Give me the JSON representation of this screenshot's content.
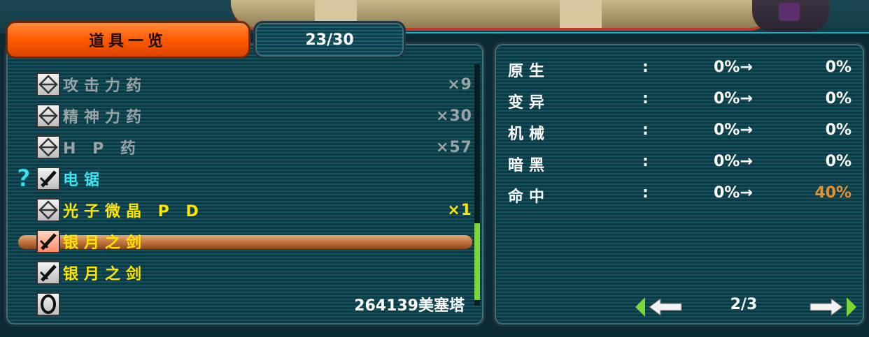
{
  "tabs": {
    "items_label": "道具一览",
    "count": "23/30"
  },
  "items": [
    {
      "name": "攻击力药",
      "qty": "×9",
      "color": "gray",
      "icon": "potion-icon",
      "unidentified": false,
      "selected": false
    },
    {
      "name": "精神力药",
      "qty": "×30",
      "color": "gray",
      "icon": "potion-icon",
      "unidentified": false,
      "selected": false
    },
    {
      "name": "H P 药",
      "qty": "×57",
      "color": "gray",
      "icon": "potion-icon",
      "unidentified": false,
      "selected": false
    },
    {
      "name": "电锯",
      "qty": "",
      "color": "cyan",
      "icon": "sword-icon",
      "unidentified": true,
      "selected": false
    },
    {
      "name": "光子微晶 P D",
      "qty": "×1",
      "color": "yellow",
      "icon": "potion-icon",
      "unidentified": false,
      "selected": false
    },
    {
      "name": "银月之剑",
      "qty": "",
      "color": "yellow",
      "icon": "sword-icon",
      "unidentified": false,
      "selected": true
    },
    {
      "name": "银月之剑",
      "qty": "",
      "color": "yellow",
      "icon": "sword-icon",
      "unidentified": false,
      "selected": false
    },
    {
      "name": "",
      "qty": "",
      "color": "gray",
      "icon": "ring-icon",
      "unidentified": false,
      "selected": false
    }
  ],
  "money": "264139美塞塔",
  "stats": [
    {
      "label": "原生",
      "colon": ":",
      "from": "0%→",
      "to": "0%",
      "improved": false
    },
    {
      "label": "变异",
      "colon": ":",
      "from": "0%→",
      "to": "0%",
      "improved": false
    },
    {
      "label": "机械",
      "colon": ":",
      "from": "0%→",
      "to": "0%",
      "improved": false
    },
    {
      "label": "暗黑",
      "colon": ":",
      "from": "0%→",
      "to": "0%",
      "improved": false
    },
    {
      "label": "命中",
      "colon": ":",
      "from": "0%→",
      "to": "40%",
      "improved": true
    }
  ],
  "pager": {
    "page": "2/3"
  },
  "colors": {
    "accent_orange": "#ff5a00",
    "scroll_green": "#7bd63a",
    "item_yellow": "#ffe400",
    "item_cyan": "#3fe2f0",
    "stat_up": "#e8902e"
  }
}
